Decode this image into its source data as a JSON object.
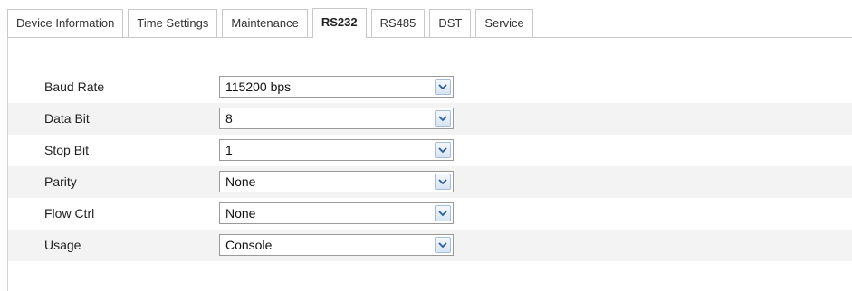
{
  "tabs": [
    {
      "label": "Device Information",
      "active": false
    },
    {
      "label": "Time Settings",
      "active": false
    },
    {
      "label": "Maintenance",
      "active": false
    },
    {
      "label": "RS232",
      "active": true
    },
    {
      "label": "RS485",
      "active": false
    },
    {
      "label": "DST",
      "active": false
    },
    {
      "label": "Service",
      "active": false
    }
  ],
  "form": {
    "rows": [
      {
        "label": "Baud Rate",
        "value": "115200 bps"
      },
      {
        "label": "Data Bit",
        "value": "8"
      },
      {
        "label": "Stop Bit",
        "value": "1"
      },
      {
        "label": "Parity",
        "value": "None"
      },
      {
        "label": "Flow Ctrl",
        "value": "None"
      },
      {
        "label": "Usage",
        "value": "Console"
      }
    ]
  },
  "icons": {
    "dropdown": "chevron-down-icon"
  },
  "colors": {
    "border": "#c8c8c8",
    "row_shade": "#f3f3f3",
    "dropdown_arrow": "#2b5b9c"
  }
}
